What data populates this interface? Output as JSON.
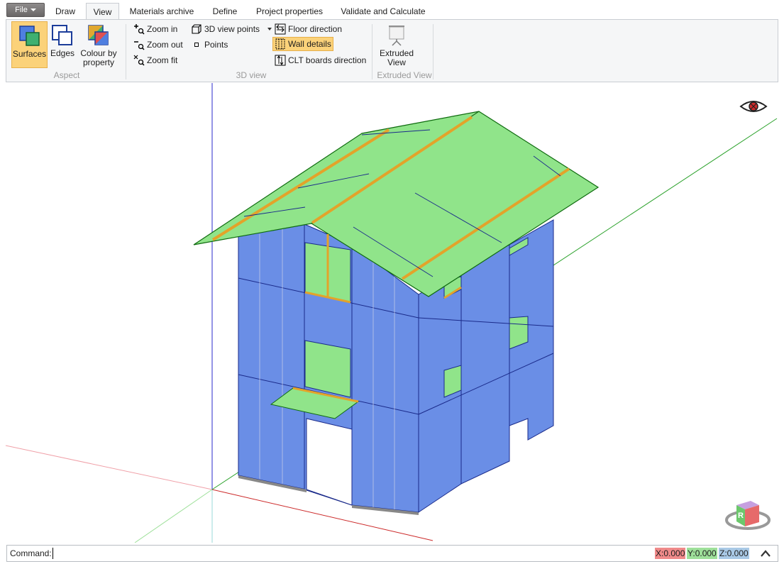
{
  "tabs": {
    "file": "File",
    "items": [
      "Draw",
      "View",
      "Materials archive",
      "Define",
      "Project properties",
      "Validate and Calculate"
    ],
    "active": "View"
  },
  "ribbon": {
    "aspect": {
      "label": "Aspect",
      "surfaces": "Surfaces",
      "edges": "Edges",
      "colour_line1": "Colour by",
      "colour_line2": "property"
    },
    "view3d": {
      "label": "3D view",
      "zoom_in": "Zoom in",
      "zoom_out": "Zoom out",
      "zoom_fit": "Zoom fit",
      "view_points": "3D view points",
      "points": "Points",
      "floor_direction": "Floor direction",
      "wall_details": "Wall details",
      "clt_direction": "CLT boards direction"
    },
    "extruded": {
      "label": "Extruded View",
      "btn_line1": "Extruded",
      "btn_line2": "View"
    }
  },
  "viewport": {
    "colors": {
      "wall": "#6a8ee6",
      "roof": "#90e48a",
      "detail": "#e3a32a",
      "axis_x": "#cc2a2a",
      "axis_y": "#2aa12a",
      "axis_z": "#2a2acc"
    },
    "view_cube": {
      "face_right": "R"
    }
  },
  "command": {
    "label": "Command:",
    "value": "",
    "x_label": "X:",
    "x": "0.000",
    "y_label": "Y:",
    "y": "0.000",
    "z_label": "Z:",
    "z": "0.000"
  }
}
